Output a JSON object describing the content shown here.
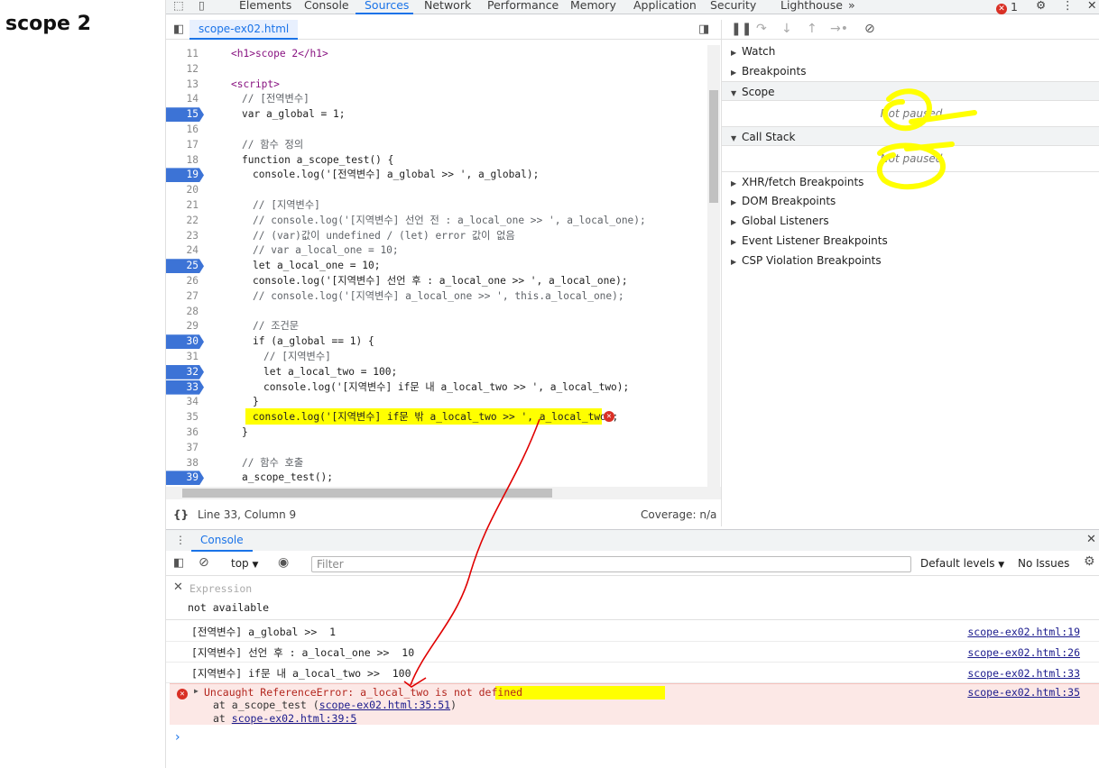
{
  "page": {
    "title": "scope 2"
  },
  "tabs": [
    "Elements",
    "Console",
    "Sources",
    "Network",
    "Performance",
    "Memory",
    "Application",
    "Security",
    "Lighthouse"
  ],
  "tabs_more": "»",
  "error_count": "1",
  "sources": {
    "file_tab": "scope-ex02.html",
    "status_position": "Line 33, Column 9",
    "coverage": "Coverage: n/a",
    "lines": [
      {
        "n": "11",
        "bp": false,
        "code": "<h1>scope 2</h1>",
        "indent": 0
      },
      {
        "n": "12",
        "bp": false,
        "code": "",
        "indent": 0
      },
      {
        "n": "13",
        "bp": false,
        "code": "<script>",
        "indent": 0
      },
      {
        "n": "14",
        "bp": false,
        "code": "// [전역변수]",
        "indent": 1
      },
      {
        "n": "15",
        "bp": true,
        "code": "var a_global = 1;",
        "indent": 1
      },
      {
        "n": "16",
        "bp": false,
        "code": "",
        "indent": 0
      },
      {
        "n": "17",
        "bp": false,
        "code": "// 함수 정의",
        "indent": 1
      },
      {
        "n": "18",
        "bp": false,
        "code": "function a_scope_test() {",
        "indent": 1
      },
      {
        "n": "19",
        "bp": true,
        "code": "console.log('[전역변수] a_global >> ', a_global);",
        "indent": 2
      },
      {
        "n": "20",
        "bp": false,
        "code": "",
        "indent": 0
      },
      {
        "n": "21",
        "bp": false,
        "code": "// [지역변수]",
        "indent": 2
      },
      {
        "n": "22",
        "bp": false,
        "code": "// console.log('[지역변수] 선언 전 : a_local_one >> ', a_local_one);",
        "indent": 2
      },
      {
        "n": "23",
        "bp": false,
        "code": "// (var)값이 undefined / (let) error 값이 없음",
        "indent": 2
      },
      {
        "n": "24",
        "bp": false,
        "code": "// var a_local_one = 10;",
        "indent": 2
      },
      {
        "n": "25",
        "bp": true,
        "code": "let a_local_one = 10;",
        "indent": 2
      },
      {
        "n": "26",
        "bp": false,
        "code": "console.log('[지역변수] 선언 후 : a_local_one >> ', a_local_one);",
        "indent": 2
      },
      {
        "n": "27",
        "bp": false,
        "code": "// console.log('[지역변수] a_local_one >> ', this.a_local_one);",
        "indent": 2
      },
      {
        "n": "28",
        "bp": false,
        "code": "",
        "indent": 0
      },
      {
        "n": "29",
        "bp": false,
        "code": "// 조건문",
        "indent": 2
      },
      {
        "n": "30",
        "bp": true,
        "code": "if (a_global == 1) {",
        "indent": 2
      },
      {
        "n": "31",
        "bp": false,
        "code": "// [지역변수]",
        "indent": 3
      },
      {
        "n": "32",
        "bp": true,
        "code": "let a_local_two = 100;",
        "indent": 3
      },
      {
        "n": "33",
        "bp": true,
        "code": "console.log('[지역변수] if문 내 a_local_two >> ', a_local_two);",
        "indent": 3
      },
      {
        "n": "34",
        "bp": false,
        "code": "}",
        "indent": 2
      },
      {
        "n": "35",
        "bp": false,
        "code": "console.log('[지역변수] if문 밖 a_local_two >> ', a_local_two);",
        "indent": 2
      },
      {
        "n": "36",
        "bp": false,
        "code": "}",
        "indent": 1
      },
      {
        "n": "37",
        "bp": false,
        "code": "",
        "indent": 0
      },
      {
        "n": "38",
        "bp": false,
        "code": "// 함수 호출",
        "indent": 1
      },
      {
        "n": "39",
        "bp": true,
        "code": "a_scope_test();",
        "indent": 1
      }
    ]
  },
  "debugger": {
    "sections": [
      "Watch",
      "Breakpoints",
      "Scope",
      "Call Stack",
      "XHR/fetch Breakpoints",
      "DOM Breakpoints",
      "Global Listeners",
      "Event Listener Breakpoints",
      "CSP Violation Breakpoints"
    ],
    "not_paused": "Not paused"
  },
  "console": {
    "tab_label": "Console",
    "context": "top",
    "filter_placeholder": "Filter",
    "levels": "Default levels",
    "issues": "No Issues",
    "expression_label": "Expression",
    "expression_value": "not available",
    "messages": [
      {
        "text": "[전역변수] a_global >>  1",
        "src": "scope-ex02.html:19"
      },
      {
        "text": "[지역변수] 선언 후 : a_local_one >>  10",
        "src": "scope-ex02.html:26"
      },
      {
        "text": "[지역변수] if문 내 a_local_two >>  100",
        "src": "scope-ex02.html:33"
      }
    ],
    "error": {
      "text": "Uncaught ReferenceError: a_local_two is not defined",
      "src": "scope-ex02.html:35",
      "stack1_prefix": "at a_scope_test (",
      "stack1_link": "scope-ex02.html:35:51",
      "stack1_suffix": ")",
      "stack2_prefix": "at ",
      "stack2_link": "scope-ex02.html:39:5"
    },
    "prompt": "›"
  },
  "colors": {
    "accent": "#1a73e8",
    "breakpoint": "#3c73d6",
    "error": "#d93025",
    "highlight": "#ffff00",
    "annotation": "#e00000"
  }
}
